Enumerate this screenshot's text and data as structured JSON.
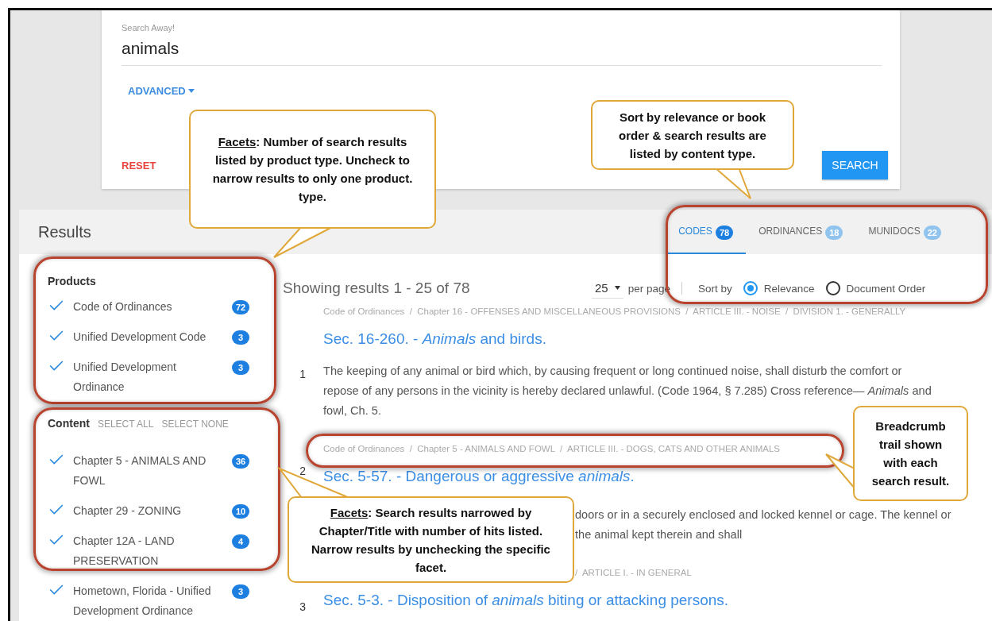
{
  "search": {
    "label": "Search Away!",
    "value": "animals",
    "advanced": "ADVANCED",
    "reset": "RESET",
    "submit": "SEARCH"
  },
  "results_header": {
    "title": "Results",
    "tabs": [
      {
        "label": "CODES",
        "count": "78",
        "selected": true
      },
      {
        "label": "ORDINANCES",
        "count": "18",
        "selected": false
      },
      {
        "label": "MUNIDOCS",
        "count": "22",
        "selected": false
      }
    ]
  },
  "facets": {
    "products": {
      "title": "Products",
      "items": [
        {
          "label": "Code of Ordinances",
          "count": "72",
          "checked": true
        },
        {
          "label": "Unified Development Code",
          "count": "3",
          "checked": true
        },
        {
          "label": "Unified Development Ordinance",
          "count": "3",
          "checked": true
        }
      ]
    },
    "content": {
      "title": "Content",
      "select_all": "SELECT ALL",
      "select_none": "SELECT NONE",
      "items": [
        {
          "label": "Chapter 5 - ANIMALS AND FOWL",
          "count": "36",
          "checked": true
        },
        {
          "label": "Chapter 29 - ZONING",
          "count": "10",
          "checked": true
        },
        {
          "label": "Chapter 12A - LAND PRESERVATION",
          "count": "4",
          "checked": true
        },
        {
          "label": "Hometown, Florida - Unified Development Ordinance",
          "count": "3",
          "checked": true
        }
      ]
    }
  },
  "summary": "Showing results 1 - 25 of 78",
  "per_page": {
    "value": "25",
    "label": "per page"
  },
  "sort": {
    "label": "Sort by",
    "options": [
      {
        "label": "Relevance",
        "selected": true
      },
      {
        "label": "Document Order",
        "selected": false
      }
    ]
  },
  "results": [
    {
      "kind": "full",
      "number": "1",
      "breadcrumb": "Code of Ordinances  /  Chapter 16 - OFFENSES AND MISCELLANEOUS PROVISIONS  /  ARTICLE III. - NOISE  /  DIVISION 1. - GENERALLY",
      "title": "Sec. 16-260. - *Animals* and birds.",
      "snippet": [
        "The keeping of any animal or bird which, by causing frequent or long continued noise, shall disturb the comfort or repose of any persons in the vicinity is hereby declared unlawful. (Code 1964, § 7.285) Cross reference— *Animals* and fowl, Ch. 5."
      ]
    },
    {
      "kind": "full",
      "number": "2",
      "breadcrumb": "Code of Ordinances  /  Chapter 5 - ANIMALS AND FOWL  /  ARTICLE III. - DOGS, CATS AND OTHER ANIMALS",
      "title": "Sec. 5-57. - Dangerous or aggressive *animals*."
    },
    {
      "kind": "clipped",
      "snippet": [
        "doors or in a securely enclosed and locked kennel or cage. The kennel or",
        "the animal kept therein and shall"
      ]
    },
    {
      "kind": "clipped",
      "breadcrumb": "/  ARTICLE I. - IN GENERAL"
    },
    {
      "kind": "full",
      "number": "3",
      "title": "Sec. 5-3. - Disposition of *animals* biting or attacking persons."
    }
  ],
  "callouts": [
    {
      "heading": "Facets",
      "text": ":  Number of search results listed by product type.  Uncheck to narrow results to only one product. type."
    },
    {
      "text": "Sort by relevance or book order & search results are listed by content type."
    },
    {
      "text": "Breadcrumb trail shown with each search result."
    },
    {
      "heading": "Facets",
      "text": ":  Search results narrowed by Chapter/Title with number of hits listed.  Narrow results by unchecking the specific facet."
    }
  ]
}
